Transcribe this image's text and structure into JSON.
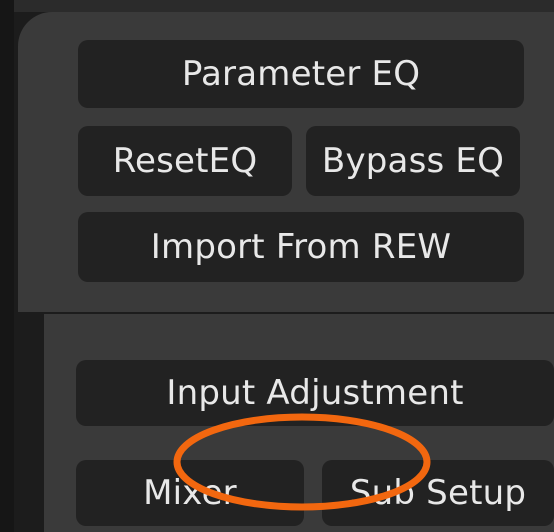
{
  "eq_section": {
    "parameter_eq_label": "Parameter EQ",
    "reset_eq_label": "ResetEQ",
    "bypass_eq_label": "Bypass EQ",
    "import_rew_label": "Import From REW"
  },
  "routing_section": {
    "input_adjustment_label": "Input Adjustment",
    "mixer_label": "Mixer",
    "sub_setup_label": "Sub Setup"
  },
  "annotation": {
    "shape": "ellipse",
    "color": "#f2670f",
    "highlights": "mixer-button"
  },
  "colors": {
    "background": "#1c1c1c",
    "panel": "#3a3a3a",
    "button": "#222222",
    "text": "#e8e8e8"
  }
}
